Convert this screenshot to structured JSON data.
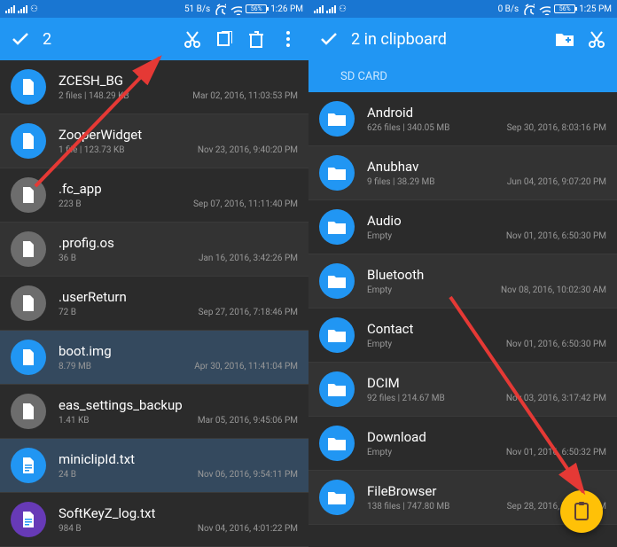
{
  "left": {
    "statusbar": {
      "rate": "51 B/s",
      "battery": "56%",
      "time": "1:26 PM"
    },
    "actionbar": {
      "count": "2"
    },
    "rows": [
      {
        "icon": "file",
        "bg": "blue",
        "title": "ZCESH_BG",
        "meta": "2 files | 148.29 KB",
        "date": "Mar 02, 2016, 11:03:53 PM"
      },
      {
        "icon": "file",
        "bg": "blue",
        "title": "ZooperWidget",
        "meta": "1 file | 123.73 KB",
        "date": "Nov 23, 2016, 9:40:20 PM"
      },
      {
        "icon": "file",
        "bg": "grey",
        "title": ".fc_app",
        "meta": "223 B",
        "date": "Sep 07, 2016, 11:11:40 PM"
      },
      {
        "icon": "file",
        "bg": "grey",
        "title": ".profig.os",
        "meta": "36 B",
        "date": "Jan 16, 2016, 3:42:26 PM"
      },
      {
        "icon": "file",
        "bg": "grey",
        "title": ".userReturn",
        "meta": "72 B",
        "date": "Sep 27, 2016, 7:18:46 PM"
      },
      {
        "icon": "file",
        "bg": "blue",
        "title": "boot.img",
        "meta": "8.79 MB",
        "date": "Apr 30, 2016, 11:41:04 PM",
        "selected": true
      },
      {
        "icon": "file",
        "bg": "grey",
        "title": "eas_settings_backup",
        "meta": "1.41 KB",
        "date": "Mar 05, 2016, 9:45:06 PM"
      },
      {
        "icon": "doc",
        "bg": "blue",
        "title": "miniclipId.txt",
        "meta": "24 B",
        "date": "Nov 06, 2016, 9:54:11 PM",
        "selected": true
      },
      {
        "icon": "doc",
        "bg": "purple",
        "title": "SoftKeyZ_log.txt",
        "meta": "984 B",
        "date": "Nov 04, 2016, 4:01:22 PM"
      }
    ]
  },
  "right": {
    "statusbar": {
      "rate": "0 B/s",
      "battery": "56%",
      "time": "1:25 PM"
    },
    "actionbar": {
      "title": "2 in clipboard"
    },
    "breadcrumb": "SD CARD",
    "rows": [
      {
        "icon": "folder",
        "bg": "blue",
        "title": "Android",
        "meta": "626 files | 340.05 MB",
        "date": "Sep 30, 2016, 8:03:16 PM"
      },
      {
        "icon": "folder",
        "bg": "blue",
        "title": "Anubhav",
        "meta": "9 files | 38.29 MB",
        "date": "Jun 04, 2016, 9:07:20 PM"
      },
      {
        "icon": "folder",
        "bg": "blue",
        "title": "Audio",
        "meta": "Empty",
        "date": "Nov 01, 2016, 6:50:30 PM"
      },
      {
        "icon": "folder",
        "bg": "blue",
        "title": "Bluetooth",
        "meta": "Empty",
        "date": "Nov 08, 2016, 10:02:30 AM"
      },
      {
        "icon": "folder",
        "bg": "blue",
        "title": "Contact",
        "meta": "Empty",
        "date": "Nov 01, 2016, 6:50:30 PM"
      },
      {
        "icon": "folder",
        "bg": "blue",
        "title": "DCIM",
        "meta": "92 files | 214.67 MB",
        "date": "Nov 03, 2016, 3:17:42 PM"
      },
      {
        "icon": "folder",
        "bg": "blue",
        "title": "Download",
        "meta": "Empty",
        "date": "Nov 01, 2016, 6:50:32 PM"
      },
      {
        "icon": "folder",
        "bg": "blue",
        "title": "FileBrowser",
        "meta": "138 files | 747.80 MB",
        "date": "Sep 28, 2016, 7:30:26 PM"
      }
    ]
  }
}
